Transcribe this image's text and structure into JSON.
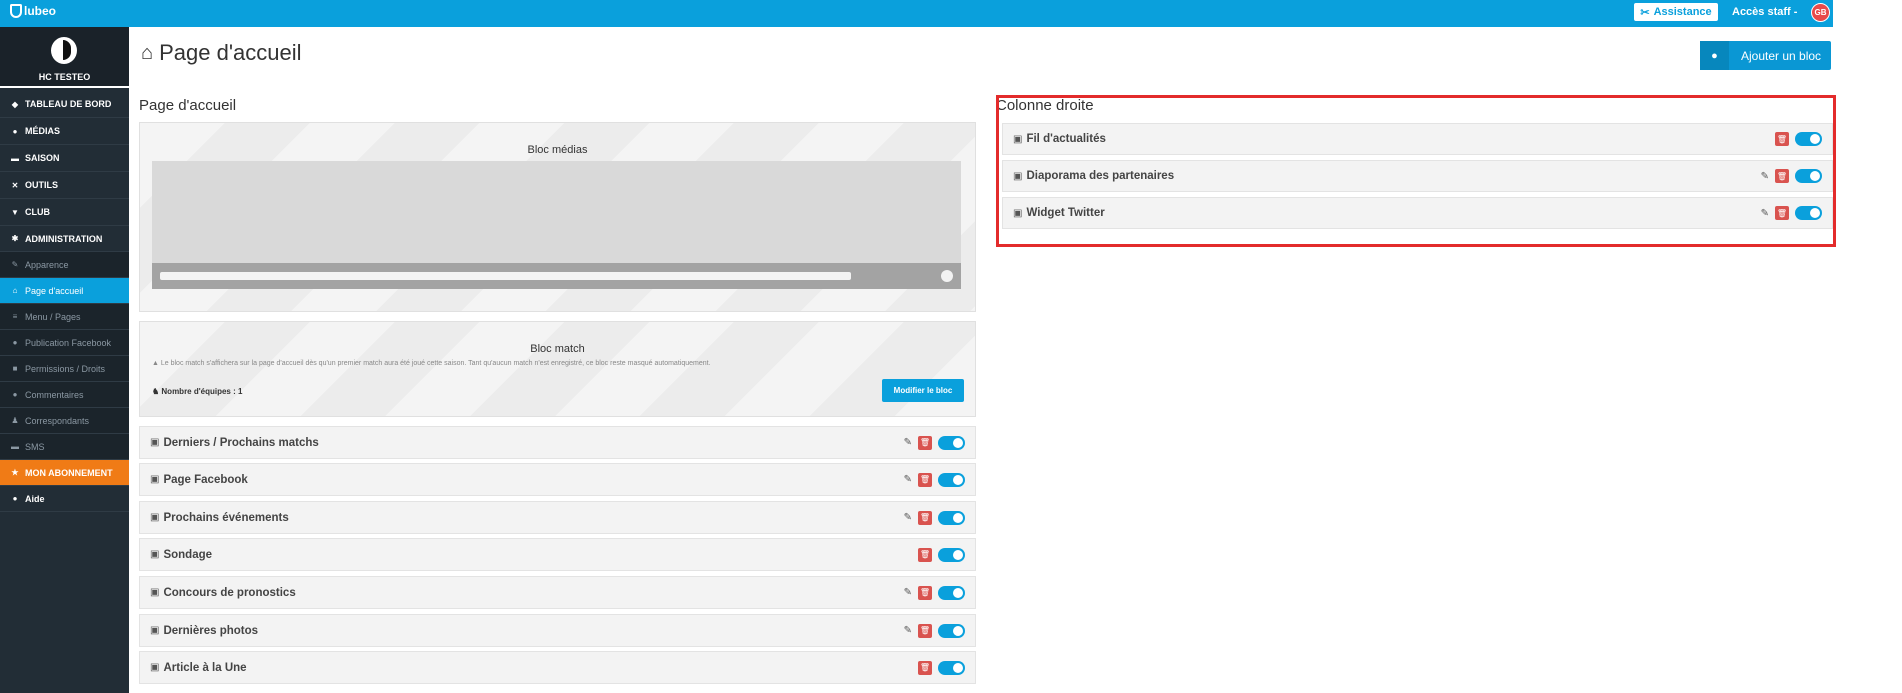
{
  "topbar": {
    "logo_text": "lubeo",
    "assistance": "Assistance",
    "staff": "Accès staff -",
    "avatar": "GB"
  },
  "club": {
    "name": "HC TESTEO"
  },
  "sidebar": {
    "items": [
      {
        "label": "TABLEAU DE BORD",
        "icon": "dashboard-icon"
      },
      {
        "label": "MÉDIAS",
        "icon": "camera-icon"
      },
      {
        "label": "SAISON",
        "icon": "calendar-icon"
      },
      {
        "label": "OUTILS",
        "icon": "tools-icon"
      },
      {
        "label": "CLUB",
        "icon": "shield-icon"
      },
      {
        "label": "ADMINISTRATION",
        "icon": "gear-icon"
      },
      {
        "label": "Apparence",
        "icon": "brush-icon"
      },
      {
        "label": "Page d'accueil",
        "icon": "home-icon"
      },
      {
        "label": "Menu / Pages",
        "icon": "menu-icon"
      },
      {
        "label": "Publication Facebook",
        "icon": "facebook-icon"
      },
      {
        "label": "Permissions / Droits",
        "icon": "lock-icon"
      },
      {
        "label": "Commentaires",
        "icon": "comment-icon"
      },
      {
        "label": "Correspondants",
        "icon": "users-icon"
      },
      {
        "label": "SMS",
        "icon": "sms-icon"
      },
      {
        "label": "MON ABONNEMENT",
        "icon": "star-icon"
      },
      {
        "label": "Aide",
        "icon": "help-icon"
      }
    ]
  },
  "main": {
    "title": "Page d'accueil",
    "add_button": "Ajouter un bloc",
    "left_title": "Page d'accueil",
    "bloc_medias": "Bloc médias",
    "bloc_match": {
      "title": "Bloc match",
      "note": "Le bloc match s'affichera sur la page d'accueil dès qu'un premier match aura été joué cette saison. Tant qu'aucun match n'est enregistré, ce bloc reste masqué automatiquement.",
      "teams": "Nombre d'équipes : 1",
      "button": "Modifier le bloc"
    },
    "left_rows": [
      {
        "name": "Derniers / Prochains matchs",
        "editable": true
      },
      {
        "name": "Page Facebook",
        "editable": true
      },
      {
        "name": "Prochains événements",
        "editable": true
      },
      {
        "name": "Sondage",
        "editable": false
      },
      {
        "name": "Concours de pronostics",
        "editable": true
      },
      {
        "name": "Dernières photos",
        "editable": true
      },
      {
        "name": "Article à la Une",
        "editable": false
      }
    ],
    "right_title": "Colonne droite",
    "right_rows": [
      {
        "name": "Fil d'actualités",
        "editable": false
      },
      {
        "name": "Diaporama des partenaires",
        "editable": true
      },
      {
        "name": "Widget Twitter",
        "editable": true
      }
    ]
  },
  "colors": {
    "primary": "#0aa0dc",
    "sidebar": "#222d36",
    "danger": "#d9534f",
    "orange": "#f07b16",
    "highlight": "#e32b2b"
  }
}
